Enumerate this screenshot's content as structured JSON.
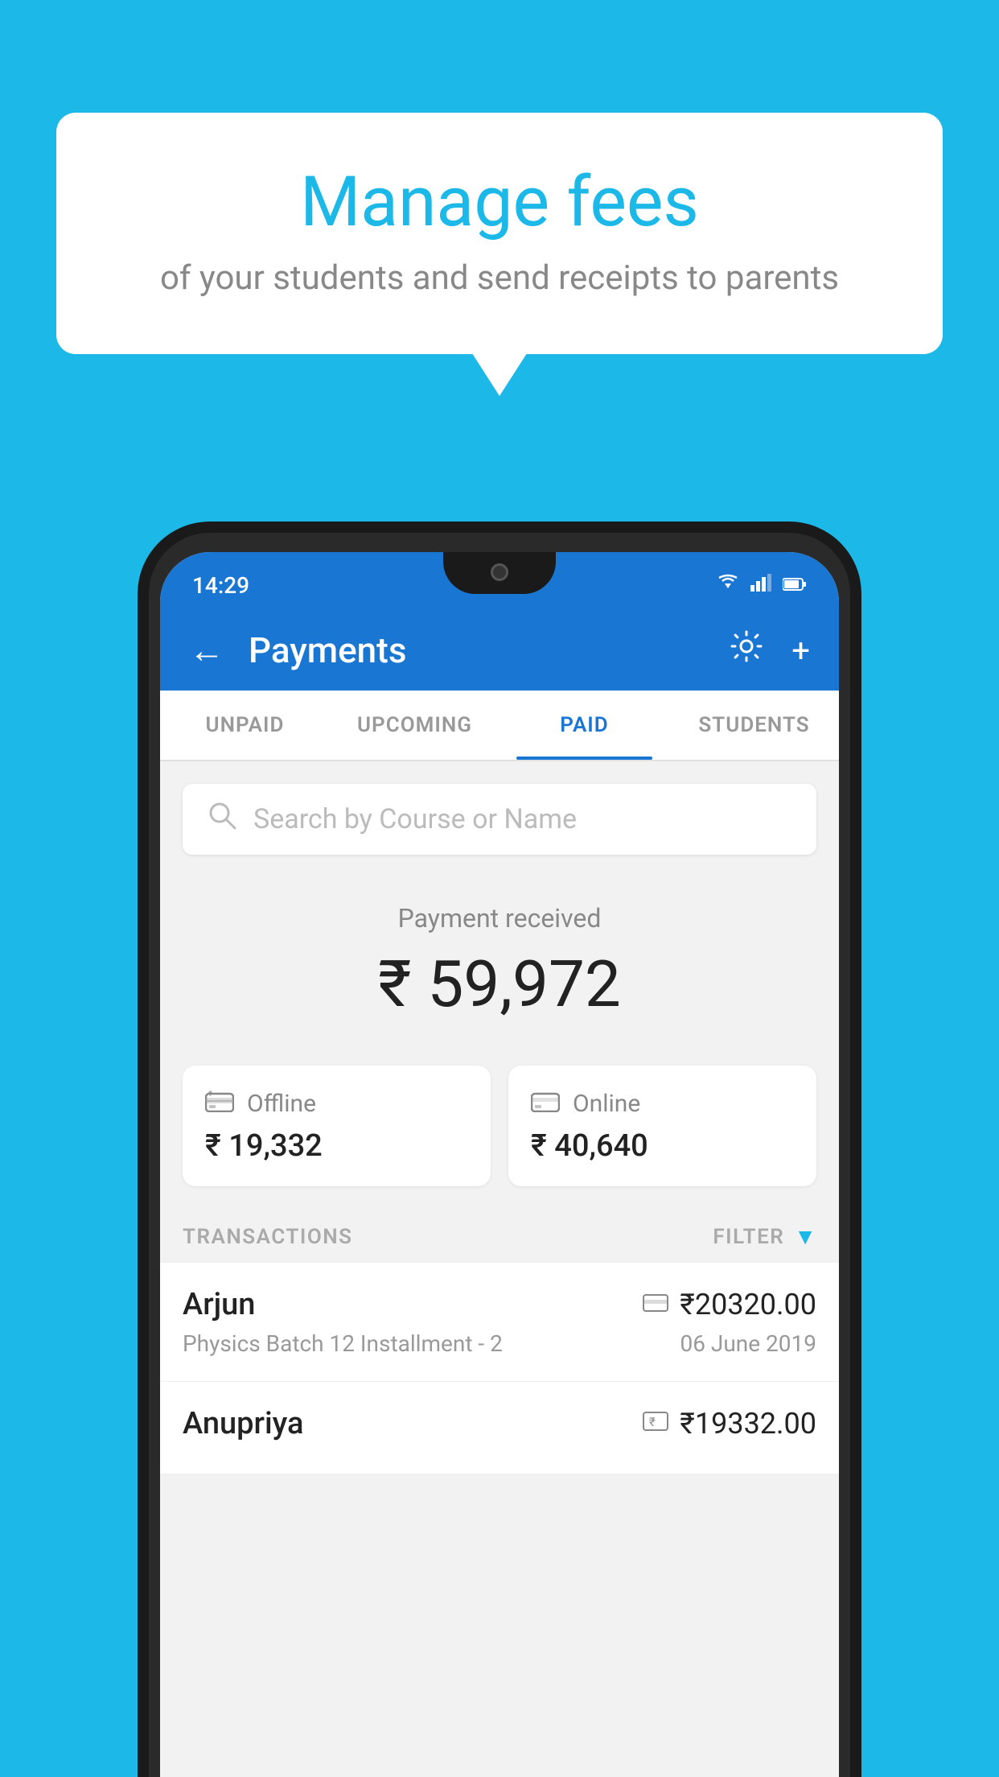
{
  "background_color": "#1BB8E8",
  "bubble": {
    "title": "Manage fees",
    "subtitle": "of your students and send receipts to parents"
  },
  "status_bar": {
    "time": "14:29",
    "wifi_icon": "▼",
    "signal_icon": "▲",
    "battery_icon": "▮"
  },
  "header": {
    "title": "Payments",
    "back_label": "←",
    "gear_label": "⚙",
    "plus_label": "+"
  },
  "tabs": [
    {
      "label": "UNPAID",
      "active": false
    },
    {
      "label": "UPCOMING",
      "active": false
    },
    {
      "label": "PAID",
      "active": true
    },
    {
      "label": "STUDENTS",
      "active": false
    }
  ],
  "search": {
    "placeholder": "Search by Course or Name"
  },
  "payment_received": {
    "label": "Payment received",
    "amount": "₹ 59,972"
  },
  "payment_cards": [
    {
      "icon": "offline",
      "label": "Offline",
      "amount": "₹ 19,332"
    },
    {
      "icon": "online",
      "label": "Online",
      "amount": "₹ 40,640"
    }
  ],
  "transactions": {
    "label": "TRANSACTIONS",
    "filter_label": "FILTER",
    "items": [
      {
        "name": "Arjun",
        "course": "Physics Batch 12 Installment - 2",
        "amount": "₹20320.00",
        "date": "06 June 2019",
        "mode": "online"
      },
      {
        "name": "Anupriya",
        "course": "",
        "amount": "₹19332.00",
        "date": "",
        "mode": "offline"
      }
    ]
  }
}
